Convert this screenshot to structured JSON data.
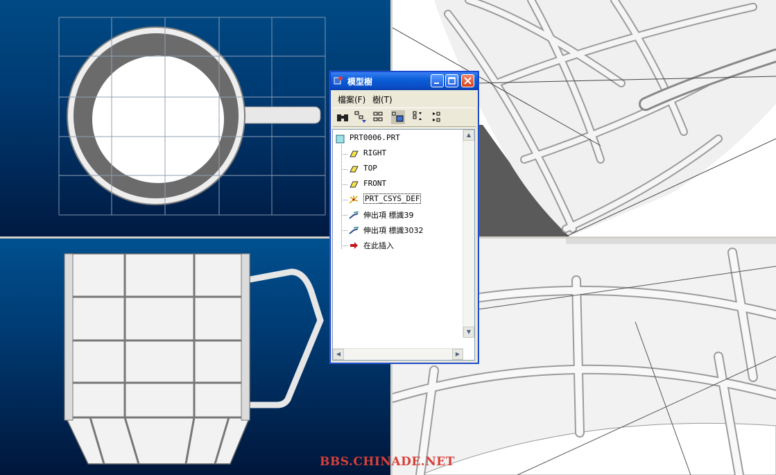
{
  "window": {
    "title": "模型樹",
    "menu": [
      {
        "label": "檔案(F)"
      },
      {
        "label": "樹(T)"
      }
    ],
    "toolbar_icons": [
      "find-icon",
      "show-tree-filter-icon",
      "settings-icon",
      "tree-columns-icon",
      "expand-icon",
      "collapse-icon"
    ]
  },
  "tree": {
    "root": "PRT0006.PRT",
    "items": [
      {
        "label": "RIGHT",
        "icon": "datum-plane-icon"
      },
      {
        "label": "TOP",
        "icon": "datum-plane-icon"
      },
      {
        "label": "FRONT",
        "icon": "datum-plane-icon"
      },
      {
        "label": "PRT_CSYS_DEF",
        "icon": "coordinate-system-icon"
      },
      {
        "label": "伸出項 標識39",
        "icon": "protrusion-icon"
      },
      {
        "label": "伸出項 標識3032",
        "icon": "protrusion-icon"
      },
      {
        "label": "在此插入",
        "icon": "insert-here-arrow-icon"
      }
    ]
  },
  "watermark": "BBS.CHINADE.NET",
  "colors": {
    "viewport_bg_top": "#004a85",
    "viewport_bg_bottom": "#001a42",
    "titlebar": "#0b5fd9",
    "watermark": "#d9403a"
  }
}
